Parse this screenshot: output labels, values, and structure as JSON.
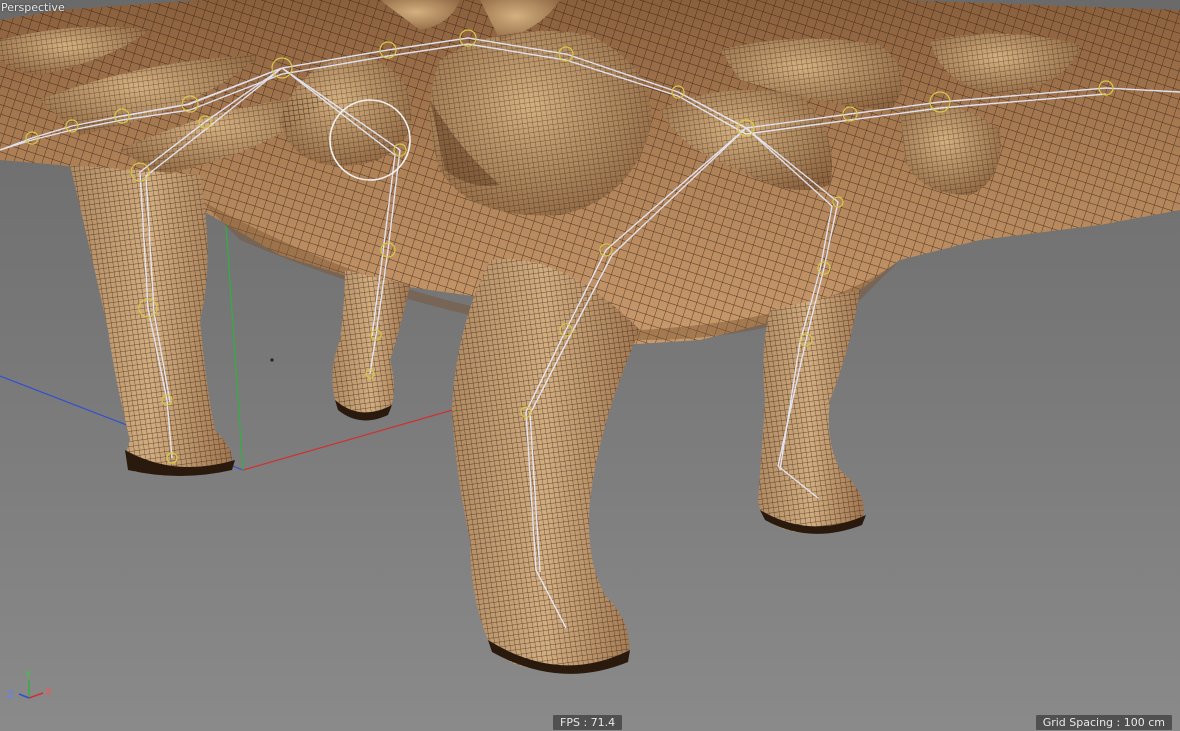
{
  "viewport": {
    "label": "Perspective",
    "fps_label": "FPS : 71.4",
    "grid_label": "Grid Spacing : 100 cm"
  },
  "axis_gizmo": {
    "y": "Y",
    "z": "Z",
    "x": "X"
  },
  "colors": {
    "skin_base": "#a87a52",
    "skin_dark": "#6e4a2c",
    "skin_light": "#d6ae7c",
    "wire": "#2a1a0e",
    "bone": "#e8ecff",
    "joint": "#d8c84a",
    "axis_x": "#d03030",
    "axis_y": "#30b040",
    "axis_z": "#3050d0"
  }
}
